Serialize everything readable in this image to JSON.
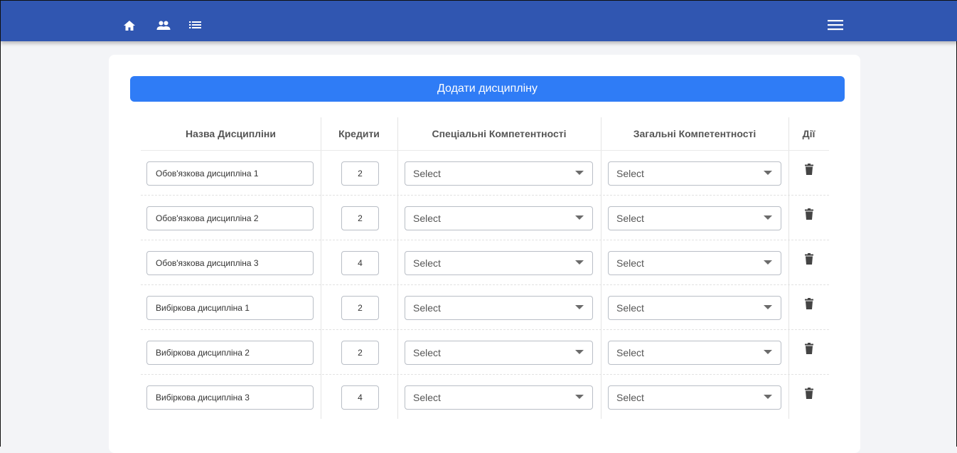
{
  "nav": {
    "icons": [
      "home-icon",
      "people-icon",
      "list-icon",
      "menu-icon"
    ]
  },
  "add_button_label": "Додати дисципліну",
  "columns": [
    "Назва Дисципліни",
    "Кредити",
    "Спеціальні Компетентності",
    "Загальні Компетентності",
    "Дії"
  ],
  "rows": [
    {
      "name": "Обов'язкова дисципліна 1",
      "credits": "2",
      "special": "Select",
      "general": "Select"
    },
    {
      "name": "Обов'язкова дисципліна 2",
      "credits": "2",
      "special": "Select",
      "general": "Select"
    },
    {
      "name": "Обов'язкова дисципліна 3",
      "credits": "4",
      "special": "Select",
      "general": "Select"
    },
    {
      "name": "Вибіркова дисципліна 1",
      "credits": "2",
      "special": "Select",
      "general": "Select"
    },
    {
      "name": "Вибіркова дисципліна 2",
      "credits": "2",
      "special": "Select",
      "general": "Select"
    },
    {
      "name": "Вибіркова дисципліна 3",
      "credits": "4",
      "special": "Select",
      "general": "Select"
    }
  ],
  "colors": {
    "topbar": "#3056b1",
    "add_button": "#2f7cf6",
    "trash": "#444444"
  }
}
